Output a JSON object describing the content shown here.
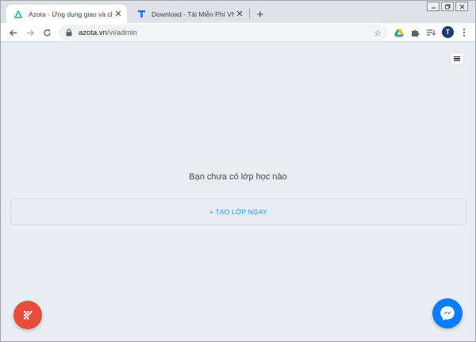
{
  "browser": {
    "tabs": [
      {
        "title": "Azota - Ứng dụng giao và chấm b",
        "active": true,
        "favicon": "azota-triangle-icon"
      },
      {
        "title": "Download - Tải Miễn Phí VN - Ph",
        "active": false,
        "favicon": "download-t-icon"
      }
    ],
    "new_tab_label": "+",
    "close_label": "✕",
    "url_host": "azota.vn",
    "url_path": "/vi/admin",
    "profile_initial": "T"
  },
  "page": {
    "empty_message": "Bạn chưa có lớp học nào",
    "create_class_label": "+ TẠO LỚP NGAY"
  },
  "colors": {
    "accent_link": "#1da1f2",
    "fab_red": "#e74c3c",
    "messenger_blue": "#0a7cff",
    "page_background": "#e9ecf1"
  }
}
